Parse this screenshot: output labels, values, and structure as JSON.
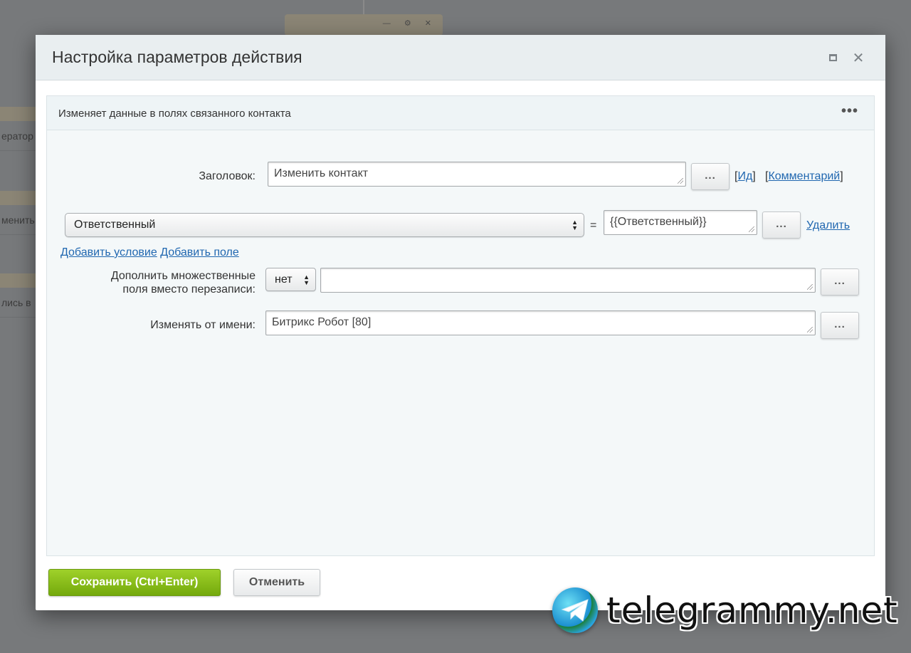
{
  "background": {
    "left_items": [
      "ератор",
      "менить",
      "лись в"
    ]
  },
  "dialog": {
    "title": "Настройка параметров действия"
  },
  "panel": {
    "title": "Изменяет данные в полях связанного контакта"
  },
  "form": {
    "title_label": "Заголовок:",
    "title_value": "Изменить контакт",
    "id_link": "Ид",
    "comment_link": "Комментарий",
    "condition_field": "Ответственный",
    "equals": "=",
    "condition_value": "{{Ответственный}}",
    "delete_link": "Удалить",
    "add_condition": "Добавить условие",
    "add_field": "Добавить поле",
    "append_label_line1": "Дополнить множественные",
    "append_label_line2": "поля вместо перезаписи:",
    "append_select": "нет",
    "append_value": "",
    "modify_as_label": "Изменять от имени:",
    "modify_as_value": "Битрикс Робот [80]",
    "dots": "..."
  },
  "footer": {
    "save_label": "Сохранить (Ctrl+Enter)",
    "cancel_label": "Отменить"
  },
  "watermark": {
    "text": "telegrammy.net"
  }
}
